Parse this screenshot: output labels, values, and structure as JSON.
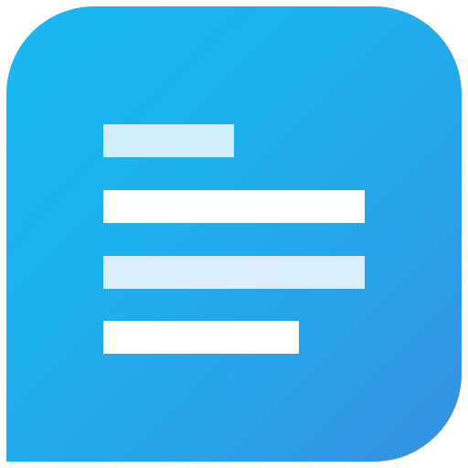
{
  "app_icon": {
    "icon_name": "notes-lines-icon",
    "colors": {
      "background_start": "#18b8f2",
      "background_end": "#3a8ee2",
      "line_light": "#d3effc",
      "line_white": "#ffffff",
      "line_faded": "#dcedfb"
    },
    "lines": [
      {
        "name": "line-1",
        "color": "#d3effc"
      },
      {
        "name": "line-2",
        "color": "#ffffff"
      },
      {
        "name": "line-3",
        "color": "#dcedfb"
      },
      {
        "name": "line-4",
        "color": "#ffffff"
      }
    ]
  }
}
